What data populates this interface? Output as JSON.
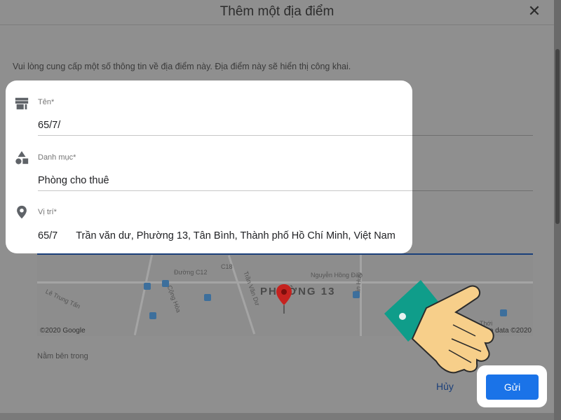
{
  "dialog": {
    "title": "Thêm một địa điểm",
    "close_icon": "close-icon",
    "intro": "Vui lòng cung cấp một số thông tin về địa điểm này. Địa điểm này sẽ hiển thị công khai."
  },
  "fields": {
    "name": {
      "label": "Tên*",
      "value": "65/7/",
      "icon": "storefront-icon"
    },
    "category": {
      "label": "Danh mục*",
      "value": "Phòng cho thuê",
      "icon": "shapes-icon"
    },
    "location": {
      "label": "Vị trí*",
      "value": "65/7",
      "value_rest": "Trần văn dư, Phường 13, Tân Bình, Thành phố Hồ Chí Minh, Việt Nam",
      "icon": "location-pin-icon"
    }
  },
  "map": {
    "area_label": "PHƯỜNG 13",
    "copyright_left": "©2020 Google",
    "copyright_right": "Map data ©2020",
    "street_labels": [
      "Lê Trung Tấn",
      "Cộng Hòa",
      "Đường C12",
      "C18",
      "Trần Văn Dư",
      "Nguyễn Hồng Đào",
      "Văn Hưu",
      "Bình Thới"
    ]
  },
  "inside_label": "Nằm bên trong",
  "actions": {
    "cancel": "Hủy",
    "submit": "Gửi"
  },
  "colors": {
    "submit_bg": "#1a73e8",
    "pin": "#c5221f",
    "sleeve": "#0f9d8a"
  }
}
